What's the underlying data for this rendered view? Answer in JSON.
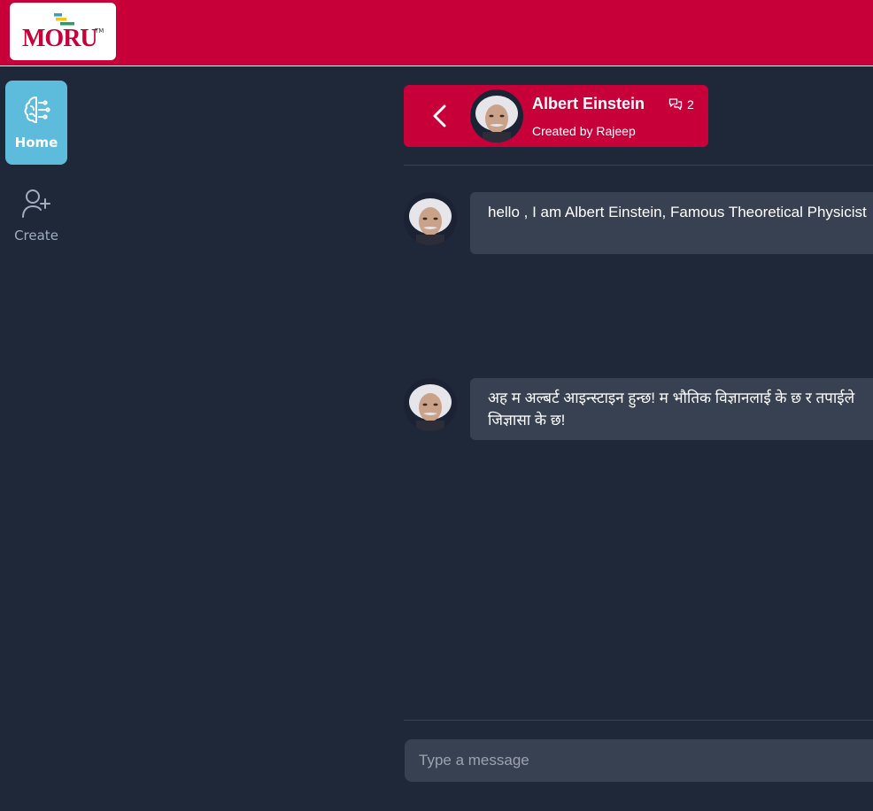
{
  "brand": {
    "logo_text": "MORU",
    "logo_tm": "TM",
    "colors": {
      "primary": "#c8003a",
      "background": "#1f2839",
      "bubble": "#374151",
      "active_nav": "#5dbcdc"
    }
  },
  "sidebar": {
    "items": [
      {
        "label": "Home",
        "icon": "brain-icon",
        "active": true
      },
      {
        "label": "Create",
        "icon": "user-plus-icon",
        "active": false
      }
    ]
  },
  "chat": {
    "character_name": "Albert Einstein",
    "chat_count": "2",
    "creator": "Created by Rajeep",
    "messages": [
      {
        "sender": "Albert Einstein",
        "text": "hello , I am Albert Einstein, Famous Theoretical Physicist"
      },
      {
        "sender": "Albert Einstein",
        "text": "अह म अल्बर्ट आइन्स्टाइन हुन्छ! म भौतिक विज्ञानलाई के छ र तपाईले जिज्ञासा के छ!"
      }
    ],
    "input_placeholder": "Type a message"
  }
}
